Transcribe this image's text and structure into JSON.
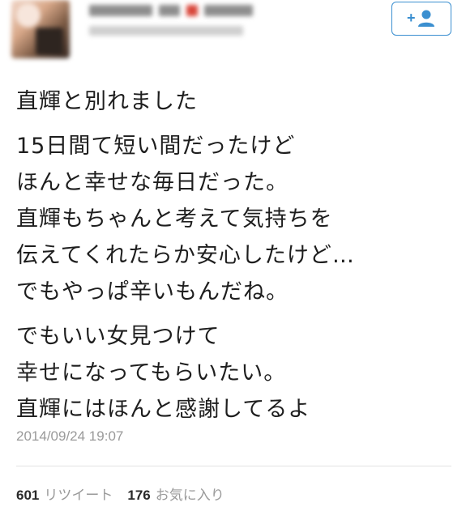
{
  "header": {
    "follow_button_icon": "add-user-icon",
    "follow_button_color": "#3b8fd0"
  },
  "tweet": {
    "paragraphs": [
      [
        "直輝と別れました"
      ],
      [
        "15日間て短い間だったけど",
        "ほんと幸せな毎日だった。",
        "直輝もちゃんと考えて気持ちを",
        "伝えてくれたらか安心したけど…",
        "でもやっぱ辛いもんだね。"
      ],
      [
        "でもいい女見つけて",
        "幸せになってもらいたい。",
        "直輝にはほんと感謝してるよ"
      ]
    ],
    "timestamp": "2014/09/24 19:07",
    "retweet_count": "601",
    "retweet_label": "リツイート",
    "favorite_count": "176",
    "favorite_label": "お気に入り"
  }
}
